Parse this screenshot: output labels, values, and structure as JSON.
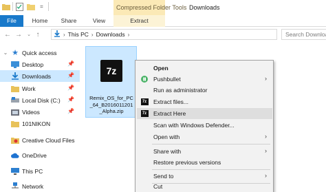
{
  "title_bar": {
    "context_tab_group": "Compressed Folder Tools",
    "window_title": "Downloads"
  },
  "ribbon": {
    "tabs": [
      "File",
      "Home",
      "Share",
      "View",
      "Extract"
    ]
  },
  "address": {
    "crumbs": [
      "This PC",
      "Downloads"
    ],
    "search_placeholder": "Search Downloads"
  },
  "sidebar": {
    "items": [
      {
        "label": "Quick access",
        "icon": "star-icon"
      },
      {
        "label": "Desktop",
        "icon": "desktop-folder-icon",
        "pinned": true
      },
      {
        "label": "Downloads",
        "icon": "downloads-folder-icon",
        "pinned": true,
        "selected": true
      },
      {
        "label": "Work",
        "icon": "folder-icon",
        "pinned": true
      },
      {
        "label": "Local Disk (C:)",
        "icon": "drive-icon",
        "pinned": true
      },
      {
        "label": "Videos",
        "icon": "videos-folder-icon",
        "pinned": true
      },
      {
        "label": "101NIKON",
        "icon": "folder-icon"
      },
      {
        "label": "Creative Cloud Files",
        "icon": "creative-cloud-icon"
      },
      {
        "label": "OneDrive",
        "icon": "onedrive-icon"
      },
      {
        "label": "This PC",
        "icon": "computer-icon"
      },
      {
        "label": "Network",
        "icon": "network-icon"
      }
    ]
  },
  "file": {
    "icon_text": "7z",
    "name_line1": "Remix_OS_for_PC",
    "name_line2": "_64_B2016011201",
    "name_line3": "_Alpha.zip"
  },
  "context_menu": {
    "items": [
      {
        "label": "Open"
      },
      {
        "label": "Pushbullet"
      },
      {
        "label": "Run as administrator"
      },
      {
        "label": "Extract files..."
      },
      {
        "label": "Extract Here"
      },
      {
        "label": "Scan with Windows Defender..."
      },
      {
        "label": "Open with"
      },
      {
        "label": "Share with"
      },
      {
        "label": "Restore previous versions"
      },
      {
        "label": "Send to"
      },
      {
        "label": "Cut"
      }
    ]
  },
  "colors": {
    "accent": "#1979ca",
    "selection": "#cce8ff",
    "context_tab": "#fbe9b6"
  }
}
